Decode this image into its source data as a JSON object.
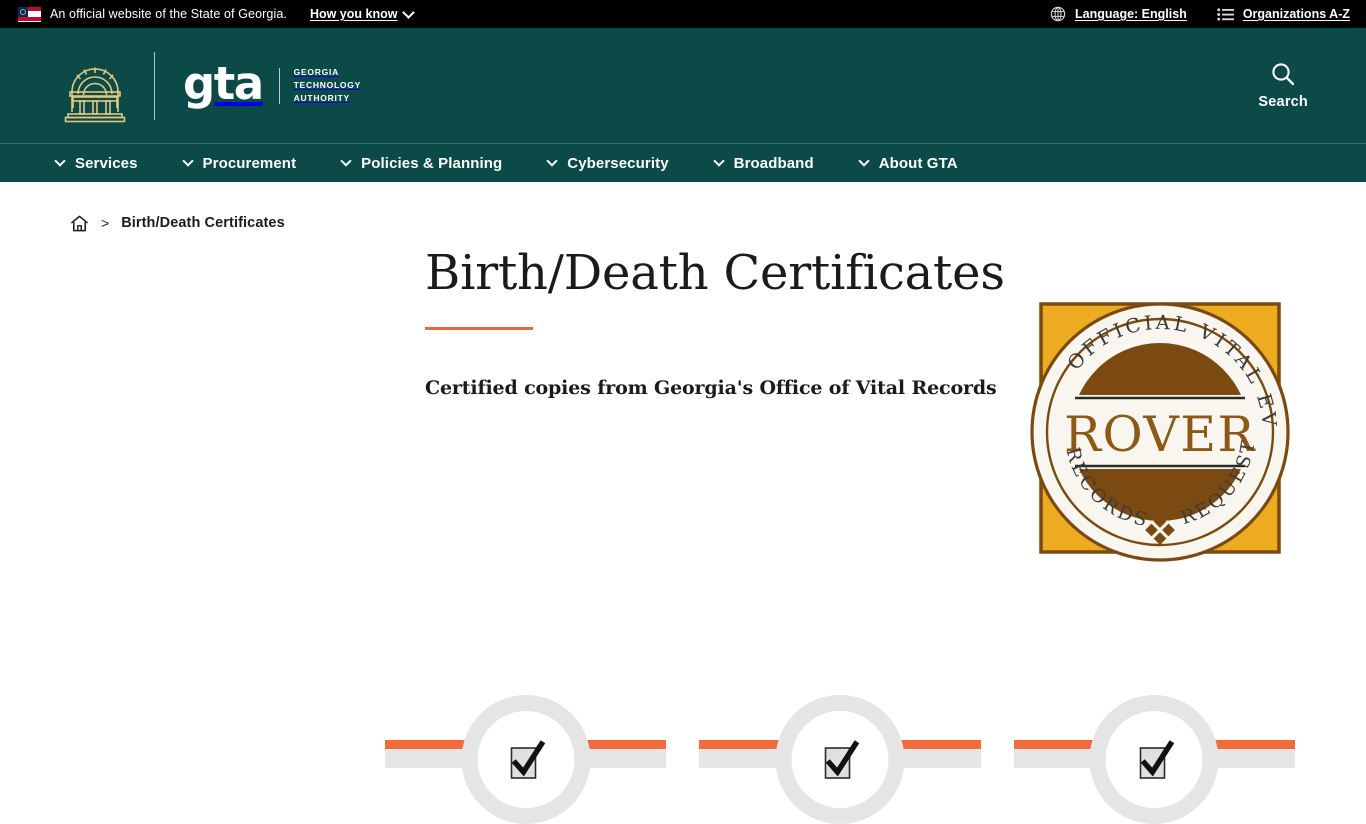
{
  "gov_bar": {
    "flag_icon": "georgia-state-flag-icon",
    "notice": "An official website of the State of Georgia.",
    "how_you_know": "How you know",
    "how_you_know_chevron": "chevron-down-icon",
    "language": {
      "icon": "globe-icon",
      "label": "Language: English"
    },
    "organizations": {
      "icon": "list-icon",
      "label": "Organizations A-Z"
    }
  },
  "masthead": {
    "emblem_icon": "georgia-arch-emblem-icon",
    "wordmark": "gta",
    "agency_name": "GEORGIA\nTECHNOLOGY\nAUTHORITY",
    "search": {
      "icon": "search-icon",
      "label": "Search"
    },
    "background_color": "#0b4a46"
  },
  "nav": {
    "items": [
      {
        "label": "Services",
        "icon": "chevron-down-icon"
      },
      {
        "label": "Procurement",
        "icon": "chevron-down-icon"
      },
      {
        "label": "Policies & Planning",
        "icon": "chevron-down-icon"
      },
      {
        "label": "Cybersecurity",
        "icon": "chevron-down-icon"
      },
      {
        "label": "Broadband",
        "icon": "chevron-down-icon"
      },
      {
        "label": "About GTA",
        "icon": "chevron-down-icon"
      }
    ]
  },
  "breadcrumb": {
    "home_icon": "home-icon",
    "separator": ">",
    "current": "Birth/Death Certificates"
  },
  "hero": {
    "title": "Birth/Death Certificates",
    "accent_color": "#e4693f",
    "subtitle": "Certified copies from Georgia's Office of Vital Records"
  },
  "seal": {
    "name": "rover-seal-icon",
    "center_text": "ROVER",
    "arc_top_text": "OFFICIAL VITAL EVENT",
    "arc_bottom_text": "REQUEST",
    "arc_right_text": "RECORDS",
    "gold_color": "#edab22",
    "brown_color": "#7a4a10",
    "cream_color": "#f7f3ea"
  },
  "cards": [
    {
      "icon": "checkmark-icon",
      "accent_color": "#f26b3a"
    },
    {
      "icon": "checkmark-icon",
      "accent_color": "#f26b3a"
    },
    {
      "icon": "checkmark-icon",
      "accent_color": "#f26b3a"
    }
  ]
}
